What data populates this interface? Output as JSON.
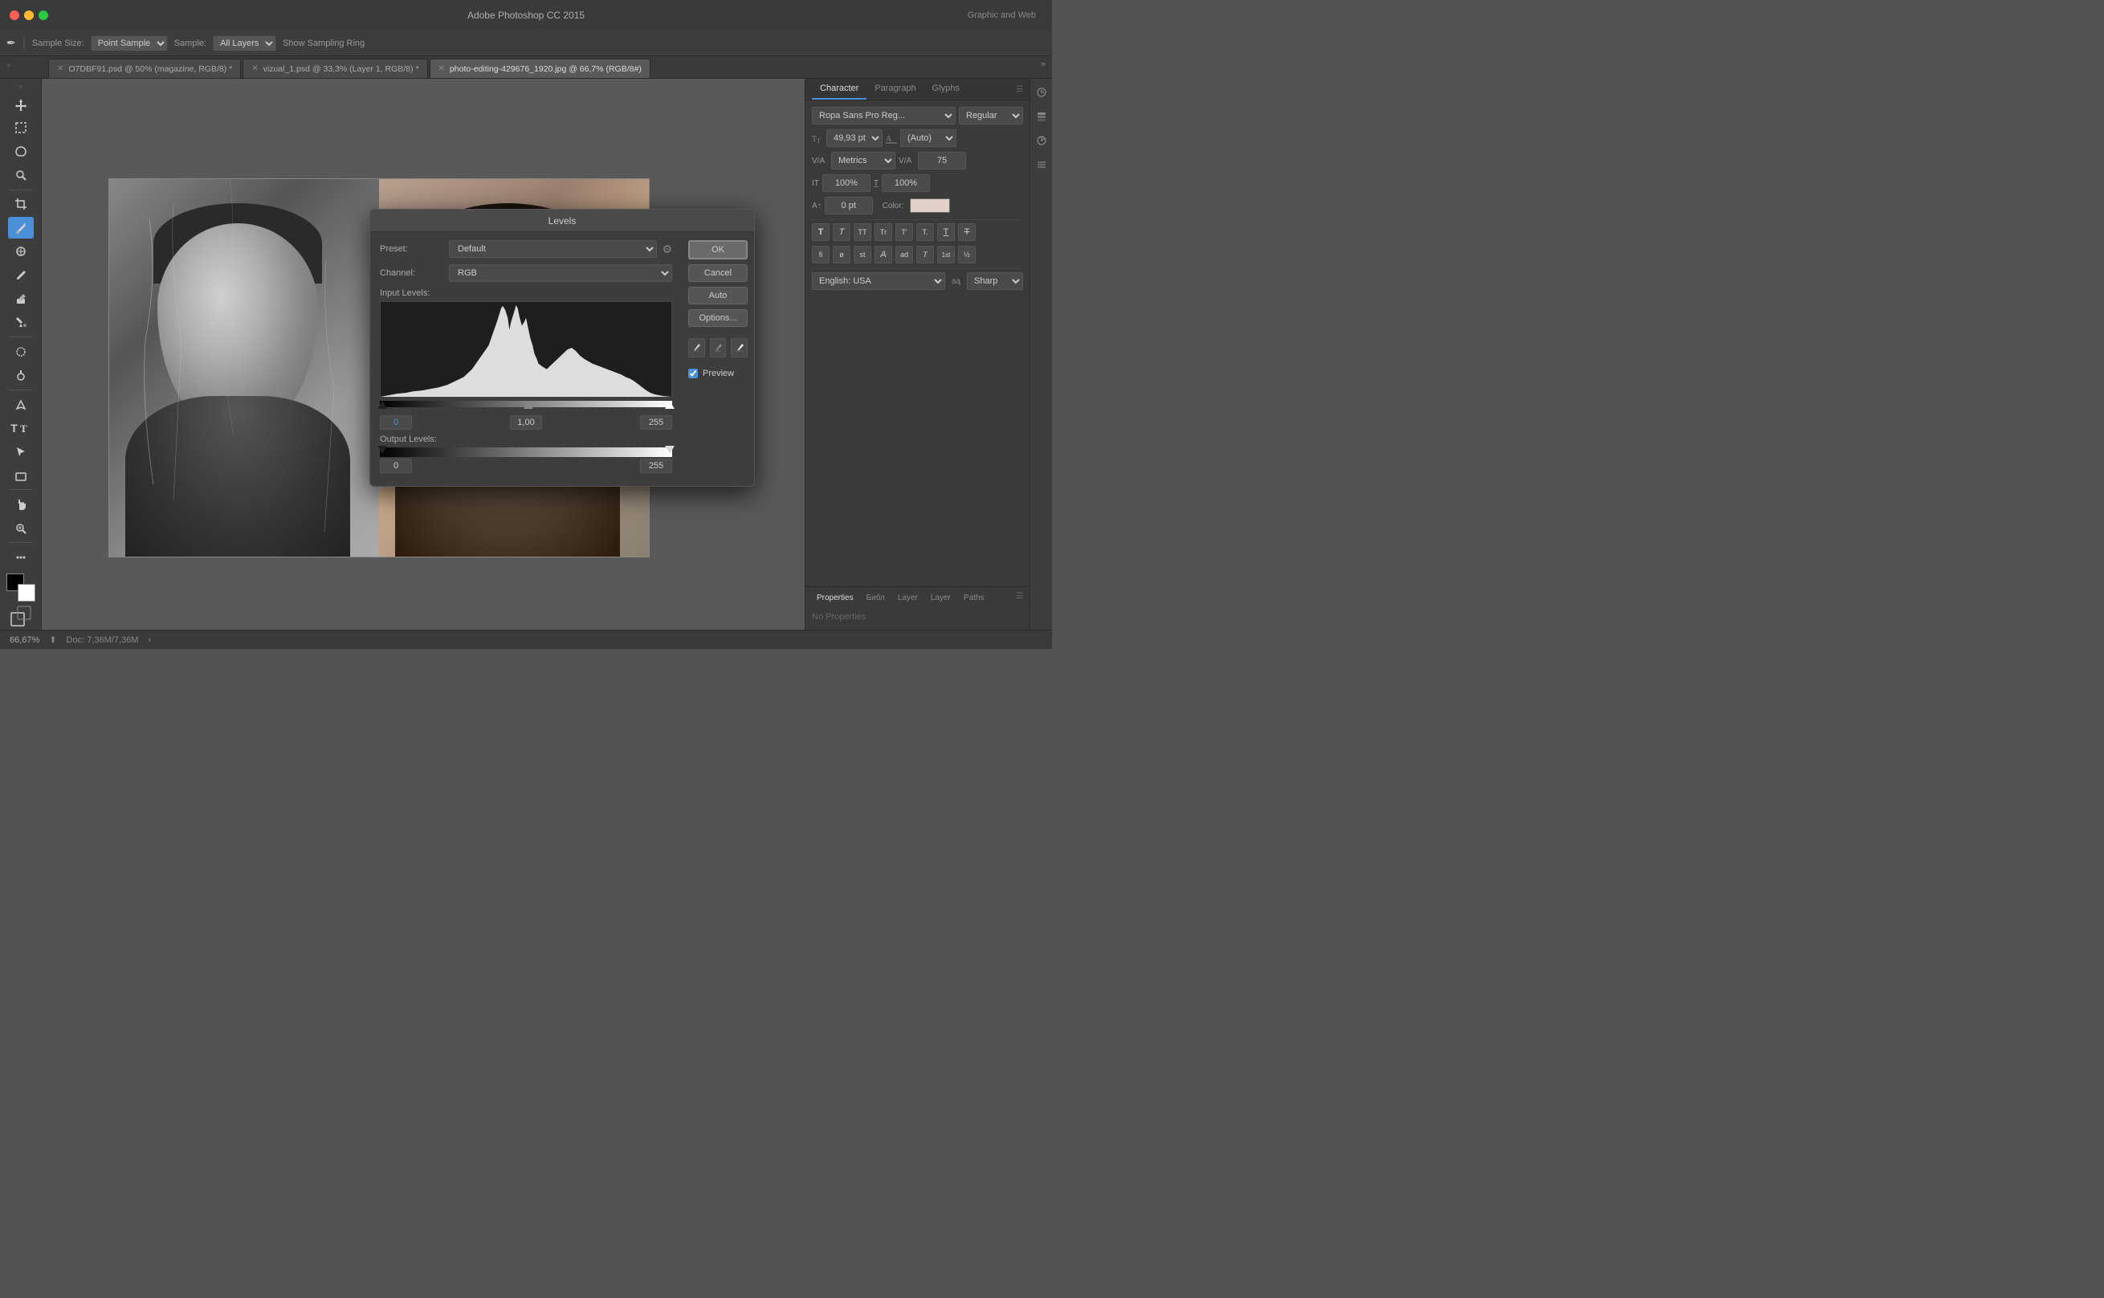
{
  "titlebar": {
    "title": "Adobe Photoshop CC 2015",
    "top_right": "Graphic and Web"
  },
  "toolbar": {
    "sample_size_label": "Sample Size:",
    "sample_size_value": "Point Sample",
    "sample_label": "Sample:",
    "sample_value": "All Layers",
    "show_sampling": "Show Sampling Ring"
  },
  "tabs": [
    {
      "label": "O7DBF91.psd @ 50% (magazine, RGB/8)",
      "active": false,
      "modified": true
    },
    {
      "label": "vizual_1.psd @ 33,3% (Layer 1, RGB/8)",
      "active": false,
      "modified": true
    },
    {
      "label": "photo-editing-429676_1920.jpg @ 66,7% (RGB/8#)",
      "active": true,
      "modified": false
    }
  ],
  "character_panel": {
    "tabs": [
      "Character",
      "Paragraph",
      "Glyphs"
    ],
    "active_tab": "Character",
    "font_family": "Ropa Sans Pro Reg...",
    "font_style": "Regular",
    "font_size": "49,93 pt",
    "leading": "(Auto)",
    "kerning": "Metrics",
    "tracking": "75",
    "scale_h": "100%",
    "scale_v": "100%",
    "baseline": "0 pt",
    "color_label": "Color:",
    "language": "English: USA",
    "anti_alias": "Sharp",
    "type_buttons": [
      "T",
      "T",
      "TT",
      "Tr",
      "T'",
      "T.",
      "T,",
      "T",
      "T"
    ],
    "type_buttons2": [
      "fi",
      "ø",
      "st",
      "A",
      "ad",
      "T",
      "1st",
      "½"
    ]
  },
  "properties_panel": {
    "tabs": [
      "Properties",
      "Библ",
      "Layer",
      "Layer",
      "Paths"
    ],
    "active_tab": "Properties",
    "no_properties": "No Properties"
  },
  "levels_dialog": {
    "title": "Levels",
    "preset_label": "Preset:",
    "preset_value": "Default",
    "channel_label": "Channel:",
    "channel_value": "RGB",
    "input_levels_label": "Input Levels:",
    "input_min": "0",
    "input_mid": "1,00",
    "input_max": "255",
    "output_levels_label": "Output Levels:",
    "output_min": "0",
    "output_max": "255",
    "buttons": {
      "ok": "OK",
      "cancel": "Cancel",
      "auto": "Auto",
      "options": "Options..."
    },
    "preview_label": "Preview",
    "preview_checked": true
  },
  "status_bar": {
    "zoom": "66,67%",
    "doc_info": "Doc: 7,36M/7,36M",
    "arrow": "›"
  },
  "tools": [
    "move",
    "marquee-rect",
    "marquee-ellipse",
    "lasso",
    "quick-select",
    "crop",
    "eyedropper",
    "spot-heal",
    "brush",
    "eraser",
    "paint-bucket",
    "blur",
    "dodge",
    "pen",
    "type",
    "path-select",
    "shape",
    "hand",
    "zoom",
    "extra"
  ],
  "colors": {
    "accent": "#4a90d9",
    "background": "#535353",
    "panel": "#3a3a3a",
    "toolbar": "#3d3d3d",
    "dialog_bg": "#3d3d3d",
    "button_bg": "#555555"
  }
}
